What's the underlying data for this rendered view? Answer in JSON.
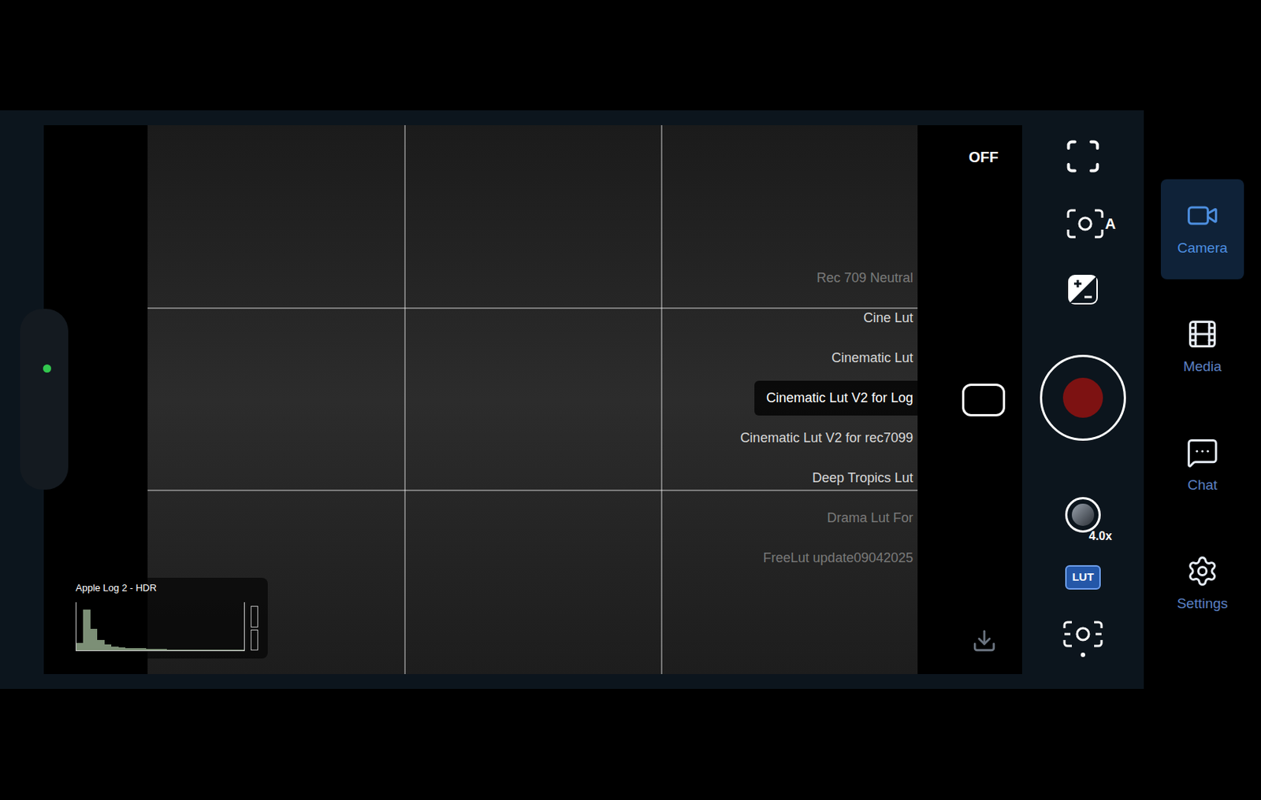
{
  "viewfinder": {
    "grid": true
  },
  "lut_menu": {
    "off_label": "OFF",
    "items": [
      {
        "label": "Rec 709 Neutral",
        "selected": false,
        "dimmed": true
      },
      {
        "label": "Cine Lut",
        "selected": false,
        "dimmed": false
      },
      {
        "label": "Cinematic Lut",
        "selected": false,
        "dimmed": false
      },
      {
        "label": "Cinematic Lut V2 for Log",
        "selected": true,
        "dimmed": false
      },
      {
        "label": "Cinematic Lut V2 for rec7099",
        "selected": false,
        "dimmed": false
      },
      {
        "label": "Deep Tropics Lut",
        "selected": false,
        "dimmed": false
      },
      {
        "label": "Drama Lut For",
        "selected": false,
        "dimmed": true
      },
      {
        "label": "FreeLut update09042025",
        "selected": false,
        "dimmed": true
      }
    ]
  },
  "histogram": {
    "label": "Apple Log 2 - HDR",
    "values": [
      0.15,
      0.85,
      0.45,
      0.22,
      0.12,
      0.08,
      0.06,
      0.05,
      0.04,
      0.04,
      0.03,
      0.03,
      0.03,
      0.02,
      0.02,
      0.02,
      0.02,
      0.02,
      0.01,
      0.01,
      0.01,
      0.01,
      0.01,
      0.01
    ]
  },
  "controls": {
    "exposure_mode": "A",
    "zoom": "4.0x",
    "lut_badge": "LUT",
    "lut_active": true
  },
  "nav": {
    "items": [
      {
        "label": "Camera",
        "selected": true
      },
      {
        "label": "Media",
        "selected": false
      },
      {
        "label": "Chat",
        "selected": false
      },
      {
        "label": "Settings",
        "selected": false
      }
    ]
  }
}
